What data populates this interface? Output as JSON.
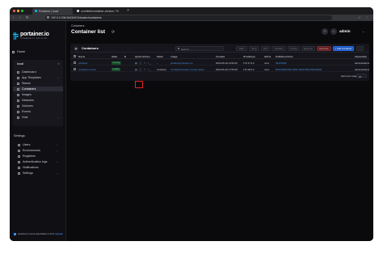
{
  "browser": {
    "tabs": [
      {
        "label": "Portainer | local"
      },
      {
        "label": "cornfield/container-version: Th"
      }
    ],
    "new_tab": "+",
    "url": "192.0.0.206:9443/#!/2/docker/containers",
    "nav": {
      "back": "‹",
      "forward": "›",
      "reload": "↻"
    },
    "toolbar_icons": "☆ ⋮"
  },
  "sidebar": {
    "logo_text": "portainer.io",
    "logo_sub": "COMMUNITY EDITION",
    "home": "Home",
    "environment": {
      "name": "local",
      "close": "✕",
      "items": [
        {
          "label": "Dashboard",
          "icon": "dashboard-icon",
          "active": false
        },
        {
          "label": "App Templates",
          "icon": "templates-icon",
          "active": false,
          "chevron": true
        },
        {
          "label": "Stacks",
          "icon": "stacks-icon",
          "active": false
        },
        {
          "label": "Containers",
          "icon": "containers-icon",
          "active": true
        },
        {
          "label": "Images",
          "icon": "images-icon",
          "active": false
        },
        {
          "label": "Networks",
          "icon": "networks-icon",
          "active": false
        },
        {
          "label": "Volumes",
          "icon": "volumes-icon",
          "active": false
        },
        {
          "label": "Events",
          "icon": "events-icon",
          "active": false
        },
        {
          "label": "Host",
          "icon": "host-icon",
          "active": false,
          "chevron": true
        }
      ]
    },
    "settings_title": "Settings",
    "settings_items": [
      {
        "label": "Users",
        "chevron": true
      },
      {
        "label": "Environments",
        "chevron": true
      },
      {
        "label": "Registries",
        "chevron": false
      },
      {
        "label": "Authentication logs",
        "chevron": true
      },
      {
        "label": "Notifications",
        "chevron": false
      },
      {
        "label": "Settings",
        "chevron": true
      }
    ],
    "footer_brand": "portainer.io",
    "footer_text": "Community Edition 2.19.4",
    "footer_upgrade": "Upgrade"
  },
  "main": {
    "breadcrumb": "Containers",
    "title": "Container list",
    "user": "admin",
    "panel": {
      "title": "Containers",
      "search_placeholder": "Search...",
      "actions": [
        {
          "label": "Start",
          "kind": "default"
        },
        {
          "label": "Stop",
          "kind": "default"
        },
        {
          "label": "Kill",
          "kind": "default"
        },
        {
          "label": "Restart",
          "kind": "default"
        },
        {
          "label": "Pause",
          "kind": "default"
        },
        {
          "label": "Resume",
          "kind": "default"
        },
        {
          "label": "Remove",
          "kind": "remove"
        },
        {
          "label": "+ Add container",
          "kind": "add"
        }
      ],
      "columns": [
        "Name",
        "State",
        "Quick Actions",
        "Stack",
        "Image",
        "Created",
        "IP Address",
        "GPUs",
        "Published Ports",
        "Ownership"
      ],
      "rows": [
        {
          "name": "portainer",
          "state": "running",
          "stack": "-",
          "image": "portainer/portainer-ce",
          "created": "2024-06-19 14:52:02",
          "ip": "172.17.0.2",
          "gpus": "none",
          "ports": "9443:9443",
          "ownership": "administrators"
        },
        {
          "name": "container-version",
          "state": "healthy",
          "stack": "container",
          "image": "cornfield/container-version:latest",
          "created": "2024-06-19 17:00:45",
          "ip": "172.18.0.2",
          "gpus": "none",
          "ports": "8000:8000  8001:8001  8002:8002  8003:8003",
          "ownership": "administrators"
        }
      ],
      "items_per_page_label": "Items per page",
      "items_per_page": "10"
    }
  }
}
